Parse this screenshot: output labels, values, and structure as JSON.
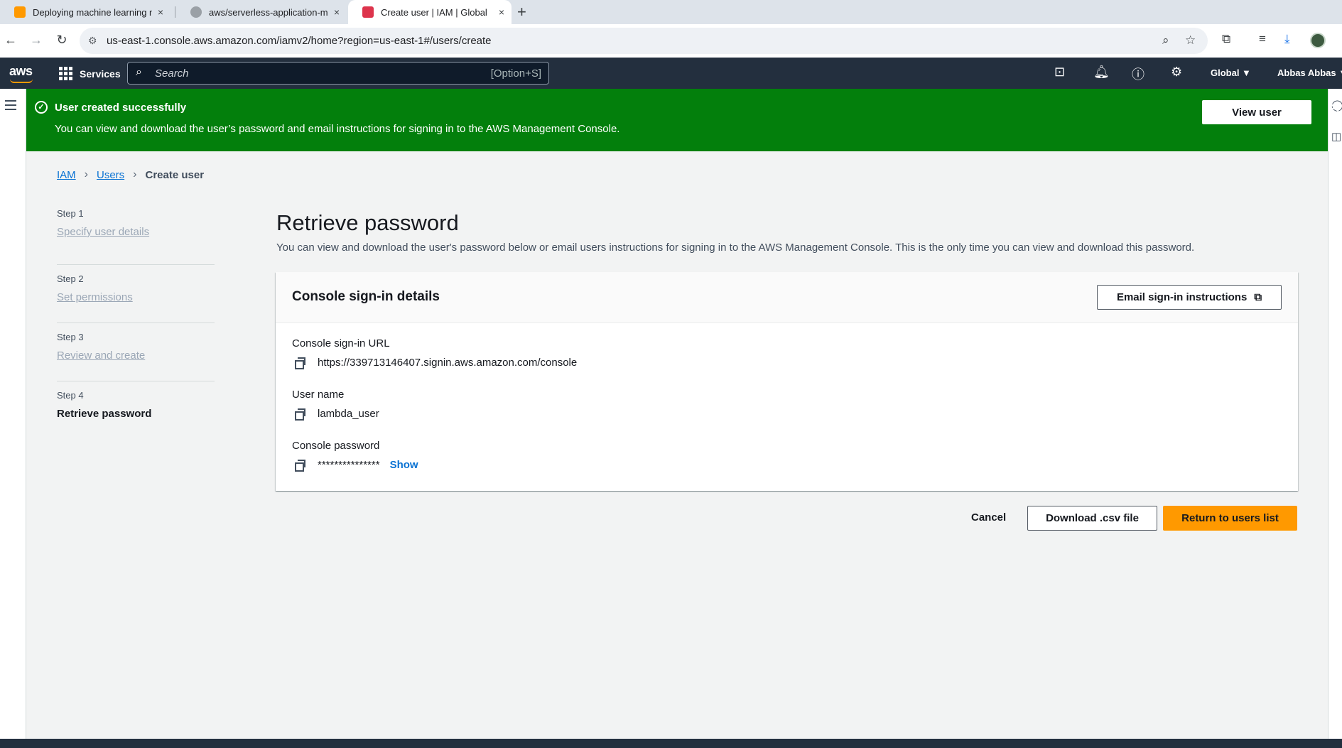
{
  "browser": {
    "tabs": [
      {
        "label": "Deploying machine learning m",
        "favicon_color": "#ff9900"
      },
      {
        "label": "aws/serverless-application-m",
        "favicon_color": "#9aa0a6"
      },
      {
        "label": "Create user | IAM | Global",
        "favicon_color": "#dd344c"
      }
    ],
    "new_tab_icon": "+",
    "close_icon": "×",
    "url": "us-east-1.console.aws.amazon.com/iamv2/home?region=us-east-1#/users/create"
  },
  "aws_nav": {
    "logo": "aws",
    "services_label": "Services",
    "search_placeholder": "Search",
    "search_shortcut": "[Option+S]",
    "region_label": "Global ▼",
    "user_label": "Abbas Abbas ▼"
  },
  "flash": {
    "title": "User created successfully",
    "message": "You can view and download the user’s password and email instructions for signing in to the AWS Management Console.",
    "view_user_label": "View user",
    "close_icon": "✕",
    "color": "#037f0c"
  },
  "breadcrumb": {
    "items": [
      "IAM",
      "Users"
    ],
    "current": "Create user"
  },
  "steps": [
    {
      "number": "Step 1",
      "label": "Specify user details"
    },
    {
      "number": "Step 2",
      "label": "Set permissions"
    },
    {
      "number": "Step 3",
      "label": "Review and create"
    },
    {
      "number": "Step 4",
      "label": "Retrieve password"
    }
  ],
  "main": {
    "title": "Retrieve password",
    "description": "You can view and download the user's password below or email users instructions for signing in to the AWS Management Console. This is the only time you can view and download this password."
  },
  "card": {
    "title": "Console sign-in details",
    "email_button_label": "Email sign-in instructions",
    "fields": [
      {
        "label": "Console sign-in URL",
        "value": "https://339713146407.signin.aws.amazon.com/console"
      },
      {
        "label": "User name",
        "value": "lambda_user"
      },
      {
        "label": "Console password",
        "value": "***************",
        "show_label": "Show"
      }
    ]
  },
  "actions": {
    "cancel_label": "Cancel",
    "download_label": "Download .csv file",
    "return_label": "Return to users list",
    "primary_color": "#ff9900"
  }
}
